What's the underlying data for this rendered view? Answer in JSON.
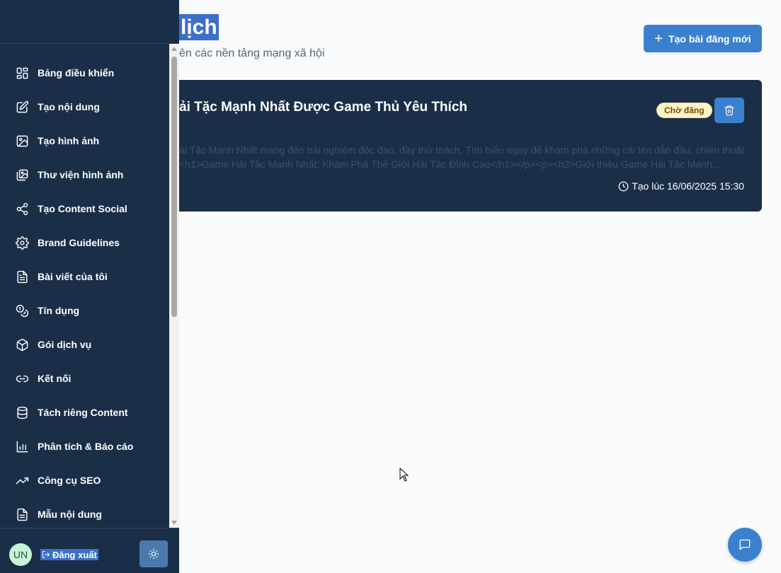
{
  "header": {
    "title": "lịch",
    "subtitle": "ên các nền tảng mạng xã hội",
    "create_button": "Tạo bài đăng mới"
  },
  "sidebar": {
    "items": [
      {
        "label": "Bảng điều khiển",
        "icon": "dashboard-icon"
      },
      {
        "label": "Tạo nội dung",
        "icon": "edit-icon"
      },
      {
        "label": "Tạo hình ảnh",
        "icon": "image-icon"
      },
      {
        "label": "Thư viện hình ảnh",
        "icon": "image-library-icon"
      },
      {
        "label": "Tạo Content Social",
        "icon": "share-icon"
      },
      {
        "label": "Brand Guidelines",
        "icon": "gear-icon"
      },
      {
        "label": "Bài viết của tôi",
        "icon": "document-icon"
      },
      {
        "label": "Tín dụng",
        "icon": "coins-icon"
      },
      {
        "label": "Gói dịch vụ",
        "icon": "package-icon"
      },
      {
        "label": "Kết nối",
        "icon": "link-icon"
      },
      {
        "label": "Tách riêng Content",
        "icon": "database-icon"
      },
      {
        "label": "Phân tích & Báo cáo",
        "icon": "bar-chart-icon"
      },
      {
        "label": "Công cụ SEO",
        "icon": "trending-up-icon"
      },
      {
        "label": "Mẫu nội dung",
        "icon": "template-icon"
      }
    ],
    "footer": {
      "avatar": "UN",
      "logout": "Đăng xuất"
    }
  },
  "post": {
    "title": "ải Tặc Mạnh Nhất Được Game Thủ Yêu Thích",
    "status": "Chờ đăng",
    "excerpt_line1": "ải Tặc Mạnh Nhất mang đến trải nghiệm độc đáo, đầy thử thách. Tìm hiểu ngay để khám phá những cái tên dẫn đầu, chiến thuật",
    "excerpt_line2": "<h1>Game Hải Tặc Mạnh Nhất: Khám Phá Thế Giới Hải Tặc Đỉnh Cao</h1></p><p><h2>Giới thiệu Game Hải Tặc Mạnh...",
    "created_at": "Tạo lúc 16/06/2025 15:30"
  },
  "colors": {
    "sidebar_bg": "#1b2e48",
    "accent": "#3b80cf",
    "selection": "#3b6fc9",
    "badge_bg": "#fdf3c7"
  }
}
